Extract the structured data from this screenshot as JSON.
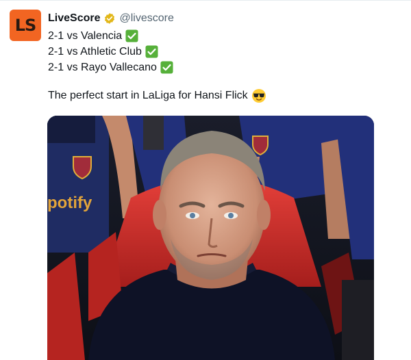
{
  "tweet": {
    "author": {
      "display_name": "LiveScore",
      "handle": "@livescore",
      "avatar_text": "LS",
      "avatar_color": "#f26522",
      "verified_badge_icon": "gold-verified-icon"
    },
    "lines": [
      {
        "text": "2-1 vs Valencia",
        "emoji": "green-check-icon"
      },
      {
        "text": "2-1 vs Athletic Club",
        "emoji": "green-check-icon"
      },
      {
        "text": "2-1 vs Rayo Vallecano",
        "emoji": "green-check-icon"
      },
      {
        "text": "The perfect start in LaLiga for Hansi Flick",
        "emoji": "sunglasses-face-icon"
      }
    ],
    "media": {
      "sponsor_fragment": "potify"
    }
  },
  "colors": {
    "text": "#0f1419",
    "secondary_text": "#536471",
    "accent_orange": "#f26522",
    "check_green": "#56b03a"
  }
}
